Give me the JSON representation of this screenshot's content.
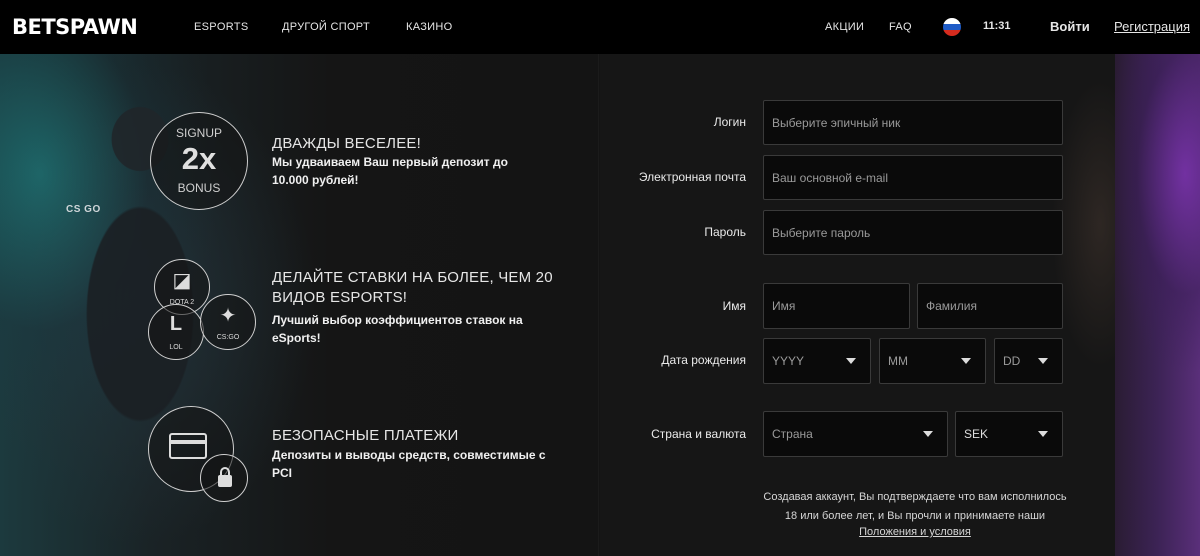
{
  "header": {
    "logo": "BETSPAWN",
    "nav": [
      "ESPORTS",
      "ДРУГОЙ СПОРТ",
      "КАЗИНО"
    ],
    "promotions": "АКЦИИ",
    "faq": "FAQ",
    "language_flag": "russia-flag",
    "time": "11:31",
    "login": "Войти",
    "register": "Регистрация"
  },
  "features": [
    {
      "badge_top": "SIGNUP",
      "badge_mid": "2x",
      "badge_bottom": "BONUS",
      "title": "ДВАЖДЫ ВЕСЕЛЕЕ!",
      "description": "Мы удваиваем Ваш первый депозит до 10.000 рублей!"
    },
    {
      "games": [
        {
          "label": "DOTA 2",
          "icon": "dota-icon"
        },
        {
          "label": "LOL",
          "icon": "lol-icon",
          "glyph": "L"
        },
        {
          "label": "CS:GO",
          "icon": "csgo-icon"
        }
      ],
      "title": "ДЕЛАЙТЕ СТАВКИ НА БОЛЕЕ, ЧЕМ 20 ВИДОВ ESPORTS!",
      "description": "Лучший выбор коэффициентов ставок на eSports!"
    },
    {
      "icons": [
        "credit-card-icon",
        "lock-icon"
      ],
      "title": "БЕЗОПАСНЫЕ ПЛАТЕЖИ",
      "description": "Депозиты и выводы средств, совместимые с PCI"
    }
  ],
  "background": {
    "patch_text": "CS GO"
  },
  "form": {
    "login": {
      "label": "Логин",
      "placeholder": "Выберите эпичный ник"
    },
    "email": {
      "label": "Электронная почта",
      "placeholder": "Ваш основной e-mail"
    },
    "password": {
      "label": "Пароль",
      "placeholder": "Выберите пароль"
    },
    "name": {
      "label": "Имя",
      "first_placeholder": "Имя",
      "last_placeholder": "Фамилия"
    },
    "birthdate": {
      "label": "Дата рождения",
      "year": "YYYY",
      "month": "MM",
      "day": "DD"
    },
    "country_currency": {
      "label": "Страна и валюта",
      "country": "Страна",
      "currency": "SEK"
    },
    "terms_line1": "Создавая аккаунт, Вы подтверждаете что вам исполнилось",
    "terms_line2": "18 или более лет, и Вы прочли и принимаете наши",
    "terms_link": "Положения и условия"
  }
}
